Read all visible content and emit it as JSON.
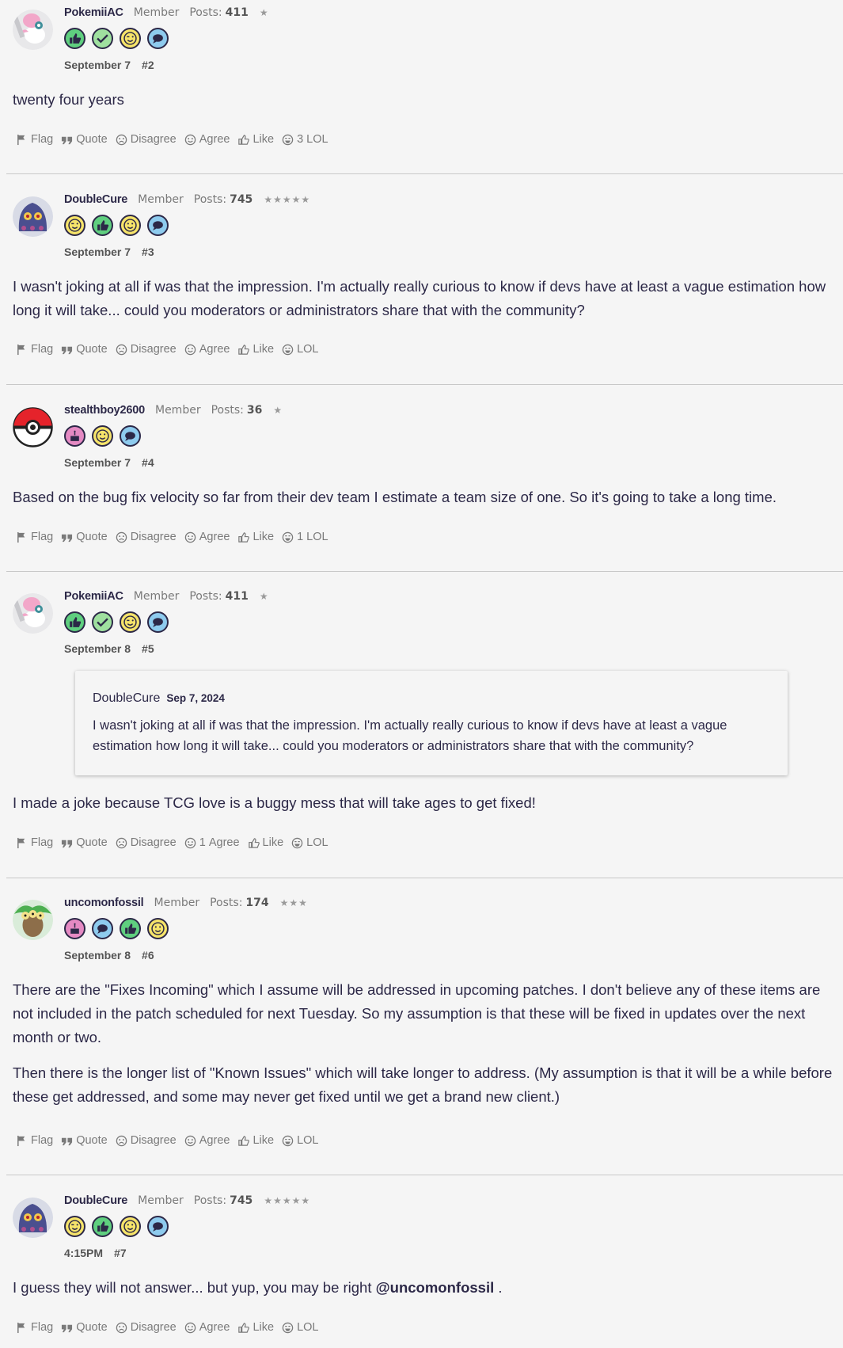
{
  "actions": {
    "flag": "Flag",
    "quote": "Quote",
    "disagree": "Disagree",
    "agree": "Agree",
    "like": "Like",
    "lol": "LOL"
  },
  "labels": {
    "posts": "Posts:"
  },
  "posts": [
    {
      "username": "PokemiiAC",
      "role": "Member",
      "posts": "411",
      "stars": "★",
      "date": "September 7",
      "number": "#2",
      "badges": [
        "thumbs-up",
        "check",
        "wink",
        "comment"
      ],
      "paragraphs": [
        "twenty four years"
      ],
      "lol_count": "3"
    },
    {
      "username": "DoubleCure",
      "role": "Member",
      "posts": "745",
      "stars": "★★★★★",
      "date": "September 7",
      "number": "#3",
      "badges": [
        "wink",
        "thumbs-up",
        "smile",
        "comment"
      ],
      "paragraphs": [
        "I wasn't joking at all if was that the impression. I'm actually really curious to know if devs have at least a vague estimation how long it will take... could you moderators or administrators share that with the community?"
      ]
    },
    {
      "username": "stealthboy2600",
      "role": "Member",
      "posts": "36",
      "stars": "★",
      "date": "September 7",
      "number": "#4",
      "badges": [
        "cake",
        "smile",
        "comment"
      ],
      "paragraphs": [
        "Based on the bug fix velocity so far from their dev team I estimate a team size of one. So it's going to take a long time."
      ],
      "lol_count": "1"
    },
    {
      "username": "PokemiiAC",
      "role": "Member",
      "posts": "411",
      "stars": "★",
      "date": "September 8",
      "number": "#5",
      "badges": [
        "thumbs-up",
        "check",
        "wink",
        "comment"
      ],
      "quote": {
        "author": "DoubleCure",
        "date": "Sep 7, 2024",
        "text": "I wasn't joking at all if was that the impression. I'm actually really curious to know if devs have at least a vague estimation how long it will take... could you moderators or administrators share that with the community?"
      },
      "paragraphs": [
        "I made a joke because TCG love is a buggy mess that will take ages to get fixed!"
      ],
      "agree_count": "1"
    },
    {
      "username": "uncomonfossil",
      "role": "Member",
      "posts": "174",
      "stars": "★★★",
      "date": "September 8",
      "number": "#6",
      "badges": [
        "cake",
        "comment",
        "thumbs-up",
        "smile"
      ],
      "paragraphs": [
        "There are the \"Fixes Incoming\" which I assume will be addressed in upcoming patches. I don't believe any of these items are not included in the patch scheduled for next Tuesday. So my assumption is that these will be fixed in updates over the next month or two.",
        "Then there is the longer list of \"Known Issues\" which will take longer to address. (My assumption is that it will be a while before these get addressed, and some may never get fixed until we get a brand new client.)"
      ]
    },
    {
      "username": "DoubleCure",
      "role": "Member",
      "posts": "745",
      "stars": "★★★★★",
      "date": "4:15PM",
      "number": "#7",
      "badges": [
        "wink",
        "thumbs-up",
        "smile",
        "comment"
      ],
      "paragraph_before_mention": "I guess they will not answer... but yup, you may be right ",
      "mention": "@uncomonfossil",
      "paragraph_after_mention": " ."
    }
  ]
}
